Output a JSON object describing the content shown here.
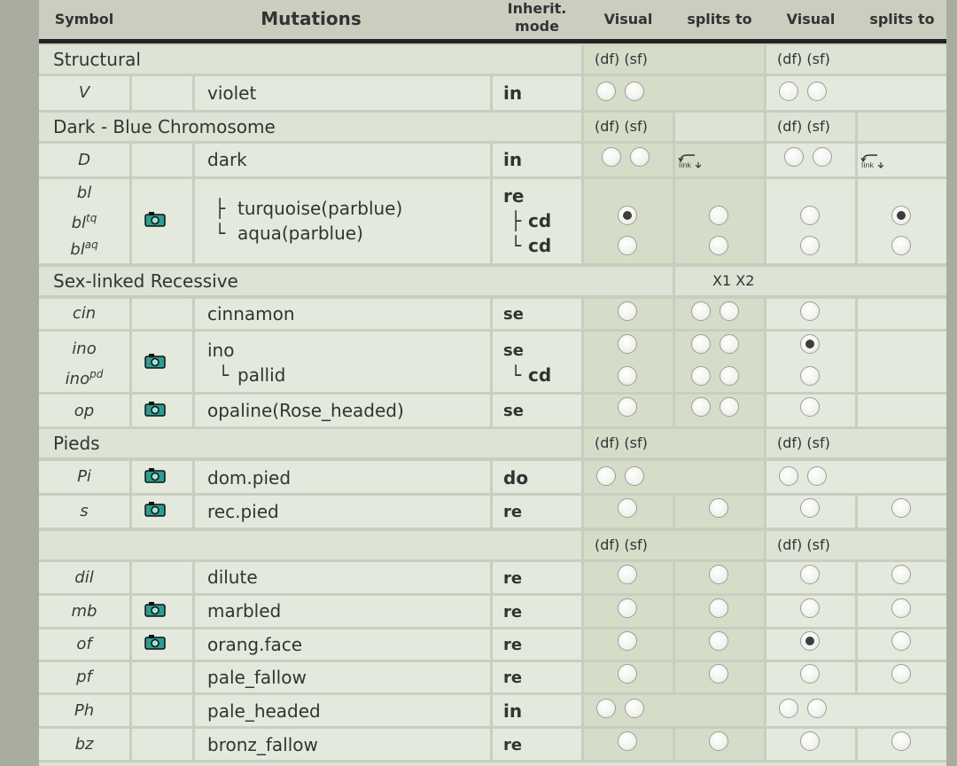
{
  "header": {
    "symbol": "Symbol",
    "mutations": "Mutations",
    "inherit_line1": "Inherit.",
    "inherit_line2": "mode",
    "visual1": "Visual",
    "splits1": "splits to",
    "visual2": "Visual",
    "splits2": "splits to"
  },
  "labels": {
    "df_sf": "(df) (sf)",
    "x1x2": "X1 X2",
    "link": "link"
  },
  "sections": {
    "structural": "Structural",
    "dark_blue": "Dark - Blue Chromosome",
    "sex_linked": "Sex-linked Recessive",
    "pieds": "Pieds",
    "other": ""
  },
  "rows": {
    "violet": {
      "sym": "V",
      "name": "violet",
      "mode": "in"
    },
    "dark": {
      "sym": "D",
      "name": "dark",
      "mode": "in"
    },
    "bl": {
      "sym": "bl",
      "sym_tq_base": "bl",
      "sym_tq_sup": "tq",
      "sym_aq_base": "bl",
      "sym_aq_sup": "aq",
      "name_tq": "turquoise(parblue)",
      "name_aq": "aqua(parblue)",
      "mode": "re",
      "mode_tq": "cd",
      "mode_aq": "cd"
    },
    "cin": {
      "sym": "cin",
      "name": "cinnamon",
      "mode": "se"
    },
    "ino": {
      "sym": "ino",
      "sym_pd_base": "ino",
      "sym_pd_sup": "pd",
      "name": "ino",
      "name_pd": "pallid",
      "mode": "se",
      "mode_pd": "cd"
    },
    "op": {
      "sym": "op",
      "name": "opaline(Rose_headed)",
      "mode": "se"
    },
    "pi": {
      "sym": "Pi",
      "name": "dom.pied",
      "mode": "do"
    },
    "s": {
      "sym": "s",
      "name": "rec.pied",
      "mode": "re"
    },
    "dil": {
      "sym": "dil",
      "name": "dilute",
      "mode": "re"
    },
    "mb": {
      "sym": "mb",
      "name": "marbled",
      "mode": "re"
    },
    "of": {
      "sym": "of",
      "name": "orang.face",
      "mode": "re"
    },
    "pf": {
      "sym": "pf",
      "name": "pale_fallow",
      "mode": "re"
    },
    "ph": {
      "sym": "Ph",
      "name": "pale_headed",
      "mode": "in"
    },
    "bz": {
      "sym": "bz",
      "name": "bronz_fallow",
      "mode": "re"
    }
  },
  "selected": {
    "bl_tq_visual1": true,
    "bl_tq_splits2": true,
    "ino_visual2": true,
    "of_visual2": true
  },
  "colors": {
    "cell": "#e3e9dc",
    "shade": "#d5ddc9",
    "border": "#c9cebf",
    "text": "#333333",
    "camera": "#2d9c93"
  }
}
